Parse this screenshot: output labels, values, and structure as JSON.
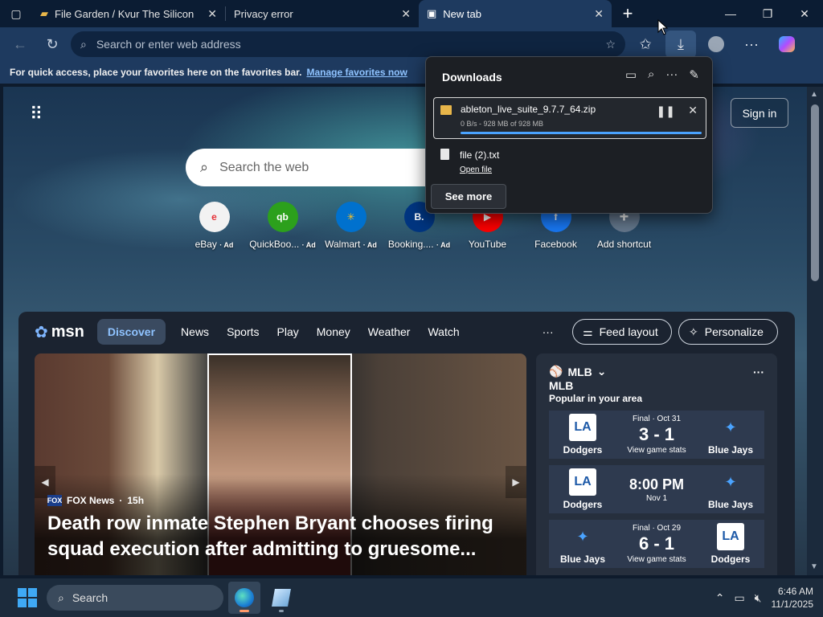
{
  "browser": {
    "tabs": [
      {
        "title": "File Garden / Kvur The Silicon",
        "icon": "folder-icon"
      },
      {
        "title": "Privacy error",
        "icon": "warning-icon"
      },
      {
        "title": "New tab",
        "icon": "new-tab-icon",
        "active": true
      }
    ],
    "address_placeholder": "Search or enter web address",
    "favorites_bar": {
      "message": "For quick access, place your favorites here on the favorites bar.",
      "link": "Manage favorites now"
    }
  },
  "newtab": {
    "sign_in": "Sign in",
    "search_placeholder": "Search the web",
    "shortcuts": [
      {
        "label": "eBay",
        "ad": "· Ad",
        "color": "#e53238"
      },
      {
        "label": "QuickBoo...",
        "ad": "· Ad",
        "color": "#2ca01c"
      },
      {
        "label": "Walmart",
        "ad": "· Ad",
        "color": "#0071ce"
      },
      {
        "label": "Booking....",
        "ad": "· Ad",
        "color": "#003580"
      },
      {
        "label": "YouTube",
        "ad": "",
        "color": "#ff0000"
      },
      {
        "label": "Facebook",
        "ad": "",
        "color": "#1877f2"
      },
      {
        "label": "Add shortcut",
        "ad": "",
        "color": "#8a96a6"
      }
    ]
  },
  "msn": {
    "logo": "msn",
    "tabs": [
      "Discover",
      "News",
      "Sports",
      "Play",
      "Money",
      "Weather",
      "Watch"
    ],
    "more": "···",
    "feed_layout": "Feed layout",
    "personalize": "Personalize",
    "hero": {
      "source": "FOX News",
      "age": "15h",
      "headline": "Death row inmate Stephen Bryant chooses firing squad execution after admitting to gruesome..."
    },
    "mlb": {
      "title": "MLB",
      "subtitle": "MLB",
      "caption": "Popular in your area",
      "games": [
        {
          "home": "Dodgers",
          "away": "Blue Jays",
          "status": "Final · Oct 31",
          "score": "3 - 1",
          "note": "View game stats",
          "home_logo": "LA",
          "away_logo": "BJ"
        },
        {
          "home": "Dodgers",
          "away": "Blue Jays",
          "status": "",
          "score": "8:00 PM",
          "note": "Nov 1",
          "home_logo": "LA",
          "away_logo": "BJ"
        },
        {
          "home": "Blue Jays",
          "away": "Dodgers",
          "status": "Final · Oct 29",
          "score": "6 - 1",
          "note": "View game stats",
          "home_logo": "BJ",
          "away_logo": "LA"
        }
      ]
    }
  },
  "downloads": {
    "title": "Downloads",
    "items": [
      {
        "name": "ableton_live_suite_9.7.7_64.zip",
        "progress": "0 B/s - 928 MB of 928 MB",
        "progress_fraction": 1.0
      },
      {
        "name": "file (2).txt",
        "action": "Open file"
      }
    ],
    "see_more": "See more"
  },
  "taskbar": {
    "search_label": "Search",
    "time": "6:46 AM",
    "date": "11/1/2025"
  }
}
